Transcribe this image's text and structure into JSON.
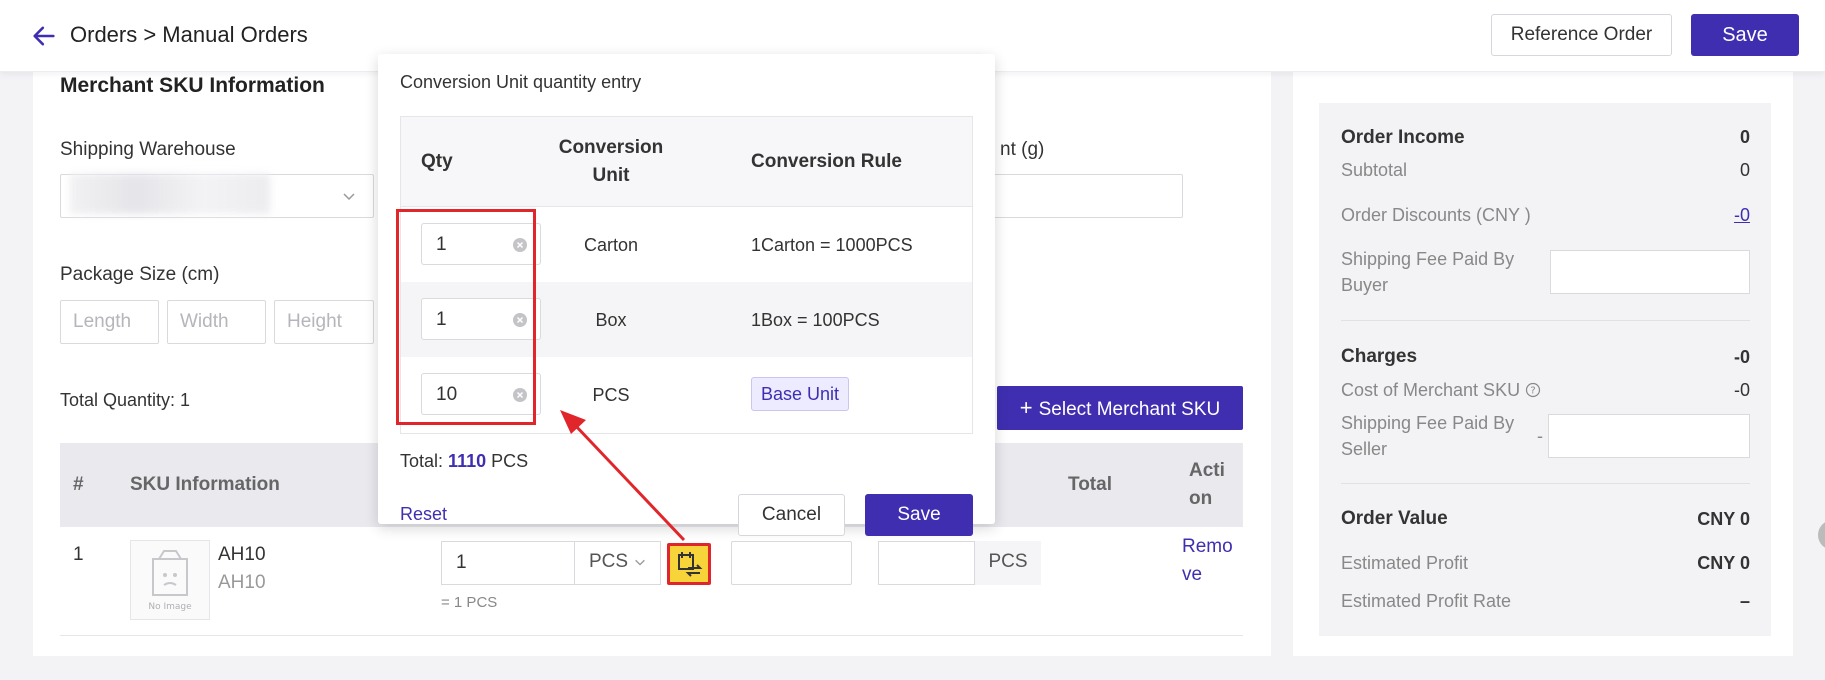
{
  "header": {
    "breadcrumb": "Orders > Manual Orders",
    "reference_order_label": "Reference Order",
    "save_label": "Save"
  },
  "merchant_sku": {
    "title": "Merchant SKU Information",
    "shipping_warehouse_label": "Shipping Warehouse",
    "weight_label_partial": "nt (g)",
    "package_size_label": "Package Size (cm)",
    "length_placeholder": "Length",
    "width_placeholder": "Width",
    "height_placeholder": "Height",
    "total_quantity": "Total Quantity: 1",
    "select_sku_label": "Select Merchant SKU",
    "table_headers": {
      "index": "#",
      "sku_info": "SKU Information",
      "total": "Total",
      "action_line1": "Acti",
      "action_line2": "on"
    },
    "row": {
      "index": "1",
      "sku_name": "AH10",
      "sku_code": "AH10",
      "qty": "1",
      "unit": "PCS",
      "note": "= 1 PCS",
      "pcs_suffix": "PCS",
      "remove_line1": "Remo",
      "remove_line2": "ve",
      "no_image": "No Image"
    }
  },
  "summary": {
    "order_income_label": "Order Income",
    "order_income_value": "0",
    "subtotal_label": "Subtotal",
    "subtotal_value": "0",
    "order_discounts_label": "Order Discounts (CNY )",
    "order_discounts_value": "-0",
    "shipping_fee_buyer_line1": "Shipping Fee Paid By",
    "shipping_fee_buyer_line2": "Buyer",
    "charges_label": "Charges",
    "charges_value": "-0",
    "cost_sku_label": "Cost of Merchant SKU",
    "cost_sku_value": "-0",
    "shipping_fee_seller_line1": "Shipping Fee Paid By",
    "shipping_fee_seller_line2": "Seller",
    "shipping_fee_seller_dash": "-",
    "order_value_label": "Order Value",
    "order_value_value": "CNY 0",
    "est_profit_label": "Estimated Profit",
    "est_profit_value": "CNY 0",
    "est_profit_rate_label": "Estimated Profit Rate",
    "est_profit_rate_value": "–"
  },
  "popup": {
    "title": "Conversion Unit quantity entry",
    "headers": {
      "qty": "Qty",
      "unit_line1": "Conversion",
      "unit_line2": "Unit",
      "rule": "Conversion Rule"
    },
    "rows": [
      {
        "qty": "1",
        "unit": "Carton",
        "rule": "1Carton = 1000PCS"
      },
      {
        "qty": "1",
        "unit": "Box",
        "rule": "1Box = 100PCS"
      },
      {
        "qty": "10",
        "unit": "PCS",
        "rule": "Base Unit"
      }
    ],
    "total_prefix": "Total:",
    "total_value": "1110",
    "total_unit": "PCS",
    "reset_label": "Reset",
    "cancel_label": "Cancel",
    "save_label": "Save"
  },
  "colors": {
    "accent": "#3f2fb0",
    "highlight": "#e0262b",
    "button_yellow": "#f7d43a"
  }
}
